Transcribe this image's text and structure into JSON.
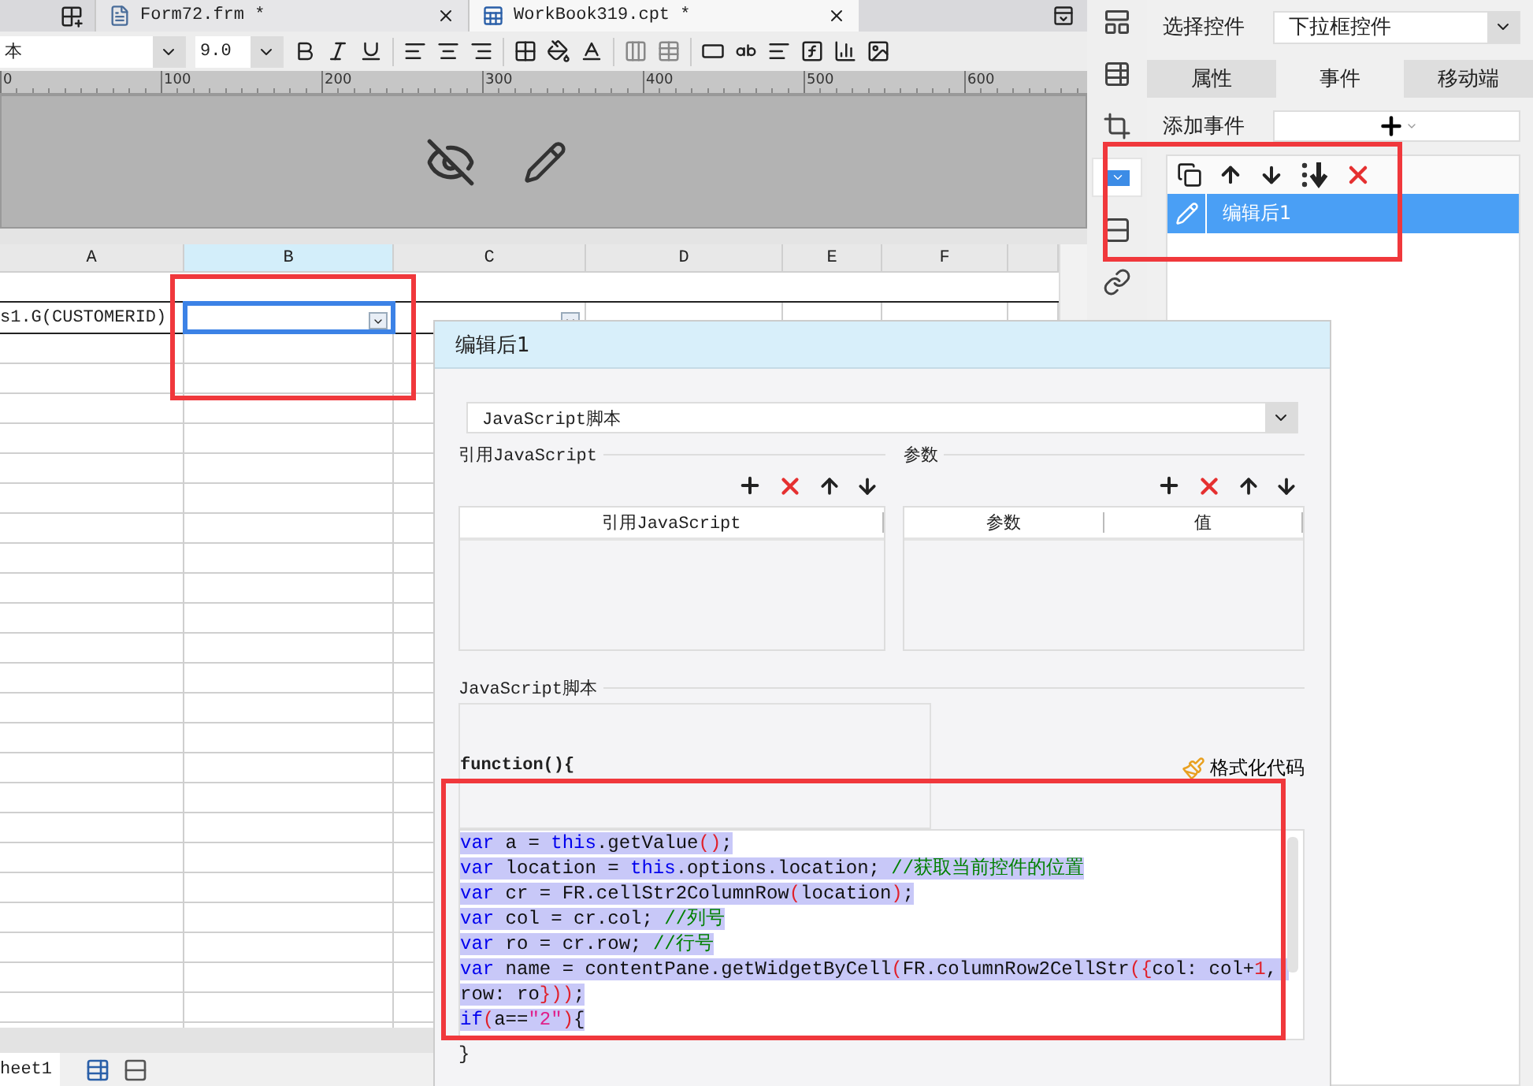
{
  "tabs": [
    {
      "label": "Form72.frm *",
      "kind": "form",
      "selected": false
    },
    {
      "label": "WorkBook319.cpt *",
      "kind": "workbook",
      "selected": true
    }
  ],
  "toolbar": {
    "font": "本",
    "size": "9.0"
  },
  "ruler": {
    "ticks": [
      "0",
      "100",
      "200",
      "300",
      "400",
      "500",
      "600"
    ]
  },
  "sheet": {
    "columns": [
      {
        "label": "A",
        "selected": false
      },
      {
        "label": "B",
        "selected": true
      },
      {
        "label": "C",
        "selected": false
      },
      {
        "label": "D",
        "selected": false
      },
      {
        "label": "E",
        "selected": false
      },
      {
        "label": "F",
        "selected": false
      }
    ],
    "data_row": [
      {
        "text": "s1.G(CUSTOMERID)",
        "selected": false,
        "widget": false
      },
      {
        "selected": true,
        "widget": true
      },
      {
        "selected": false,
        "widget": true
      }
    ]
  },
  "sheet_tabs": [
    {
      "label": "heet1",
      "selected": true
    }
  ],
  "side_tools": [
    {
      "kind": "layout",
      "selected": false
    },
    {
      "kind": "table-info",
      "selected": false
    },
    {
      "kind": "frame",
      "selected": false
    },
    {
      "kind": "dropdown",
      "selected": true
    },
    {
      "kind": "rows",
      "selected": false
    },
    {
      "kind": "link",
      "selected": false
    }
  ],
  "panel": {
    "select_label": "选择控件",
    "select_value": "下拉框控件",
    "tabs": [
      {
        "label": "属性",
        "selected": false
      },
      {
        "label": "事件",
        "selected": true
      },
      {
        "label": "移动端",
        "selected": false
      }
    ],
    "add_event_label": "添加事件",
    "events": [
      {
        "label": "编辑后1",
        "selected": true
      }
    ]
  },
  "dialog": {
    "title": "编辑后1",
    "type": "JavaScript脚本",
    "ref_section": "引用JavaScript",
    "ref_columns": [
      "引用JavaScript"
    ],
    "param_section": "参数",
    "param_columns": [
      "参数",
      "值"
    ],
    "script_section": "JavaScript脚本",
    "function_open": "function(){",
    "format_button": "格式化代码",
    "code": {
      "selected": true,
      "lines": [
        [
          {
            "kind": "keyword",
            "t": "var"
          },
          {
            "kind": "plain",
            "t": " a = "
          },
          {
            "kind": "keyword",
            "t": "this"
          },
          {
            "kind": "plain",
            "t": ".getValue"
          },
          {
            "kind": "bracket",
            "t": "()"
          },
          {
            "kind": "plain",
            "t": ";"
          }
        ],
        [
          {
            "kind": "keyword",
            "t": "var"
          },
          {
            "kind": "plain",
            "t": " location = "
          },
          {
            "kind": "keyword",
            "t": "this"
          },
          {
            "kind": "plain",
            "t": ".options.location; "
          },
          {
            "kind": "comment",
            "t": "//获取当前控件的位置"
          }
        ],
        [
          {
            "kind": "keyword",
            "t": "var"
          },
          {
            "kind": "plain",
            "t": " cr = FR.cellStr2ColumnRow"
          },
          {
            "kind": "bracket",
            "t": "("
          },
          {
            "kind": "plain",
            "t": "location"
          },
          {
            "kind": "bracket",
            "t": ")"
          },
          {
            "kind": "plain",
            "t": ";"
          }
        ],
        [
          {
            "kind": "keyword",
            "t": "var"
          },
          {
            "kind": "plain",
            "t": " col = cr.col; "
          },
          {
            "kind": "comment",
            "t": "//列号"
          }
        ],
        [
          {
            "kind": "keyword",
            "t": "var"
          },
          {
            "kind": "plain",
            "t": " ro = cr.row; "
          },
          {
            "kind": "comment",
            "t": "//行号"
          }
        ],
        [
          {
            "kind": "keyword",
            "t": "var"
          },
          {
            "kind": "plain",
            "t": " name = contentPane.getWidgetByCell"
          },
          {
            "kind": "bracket",
            "t": "("
          },
          {
            "kind": "plain",
            "t": "FR.columnRow2CellStr"
          },
          {
            "kind": "bracket",
            "t": "({"
          },
          {
            "kind": "plain",
            "t": "col: col+"
          },
          {
            "kind": "number",
            "t": "1"
          },
          {
            "kind": "plain",
            "t": ", row: ro"
          },
          {
            "kind": "bracket",
            "t": "}))"
          },
          {
            "kind": "plain",
            "t": ";"
          }
        ],
        [
          {
            "kind": "keyword",
            "t": "if"
          },
          {
            "kind": "bracket",
            "t": "("
          },
          {
            "kind": "plain",
            "t": "a=="
          },
          {
            "kind": "string",
            "t": "\"2\""
          },
          {
            "kind": "bracket",
            "t": ")"
          },
          {
            "kind": "plain",
            "t": "{"
          }
        ]
      ]
    },
    "function_close": "}"
  }
}
